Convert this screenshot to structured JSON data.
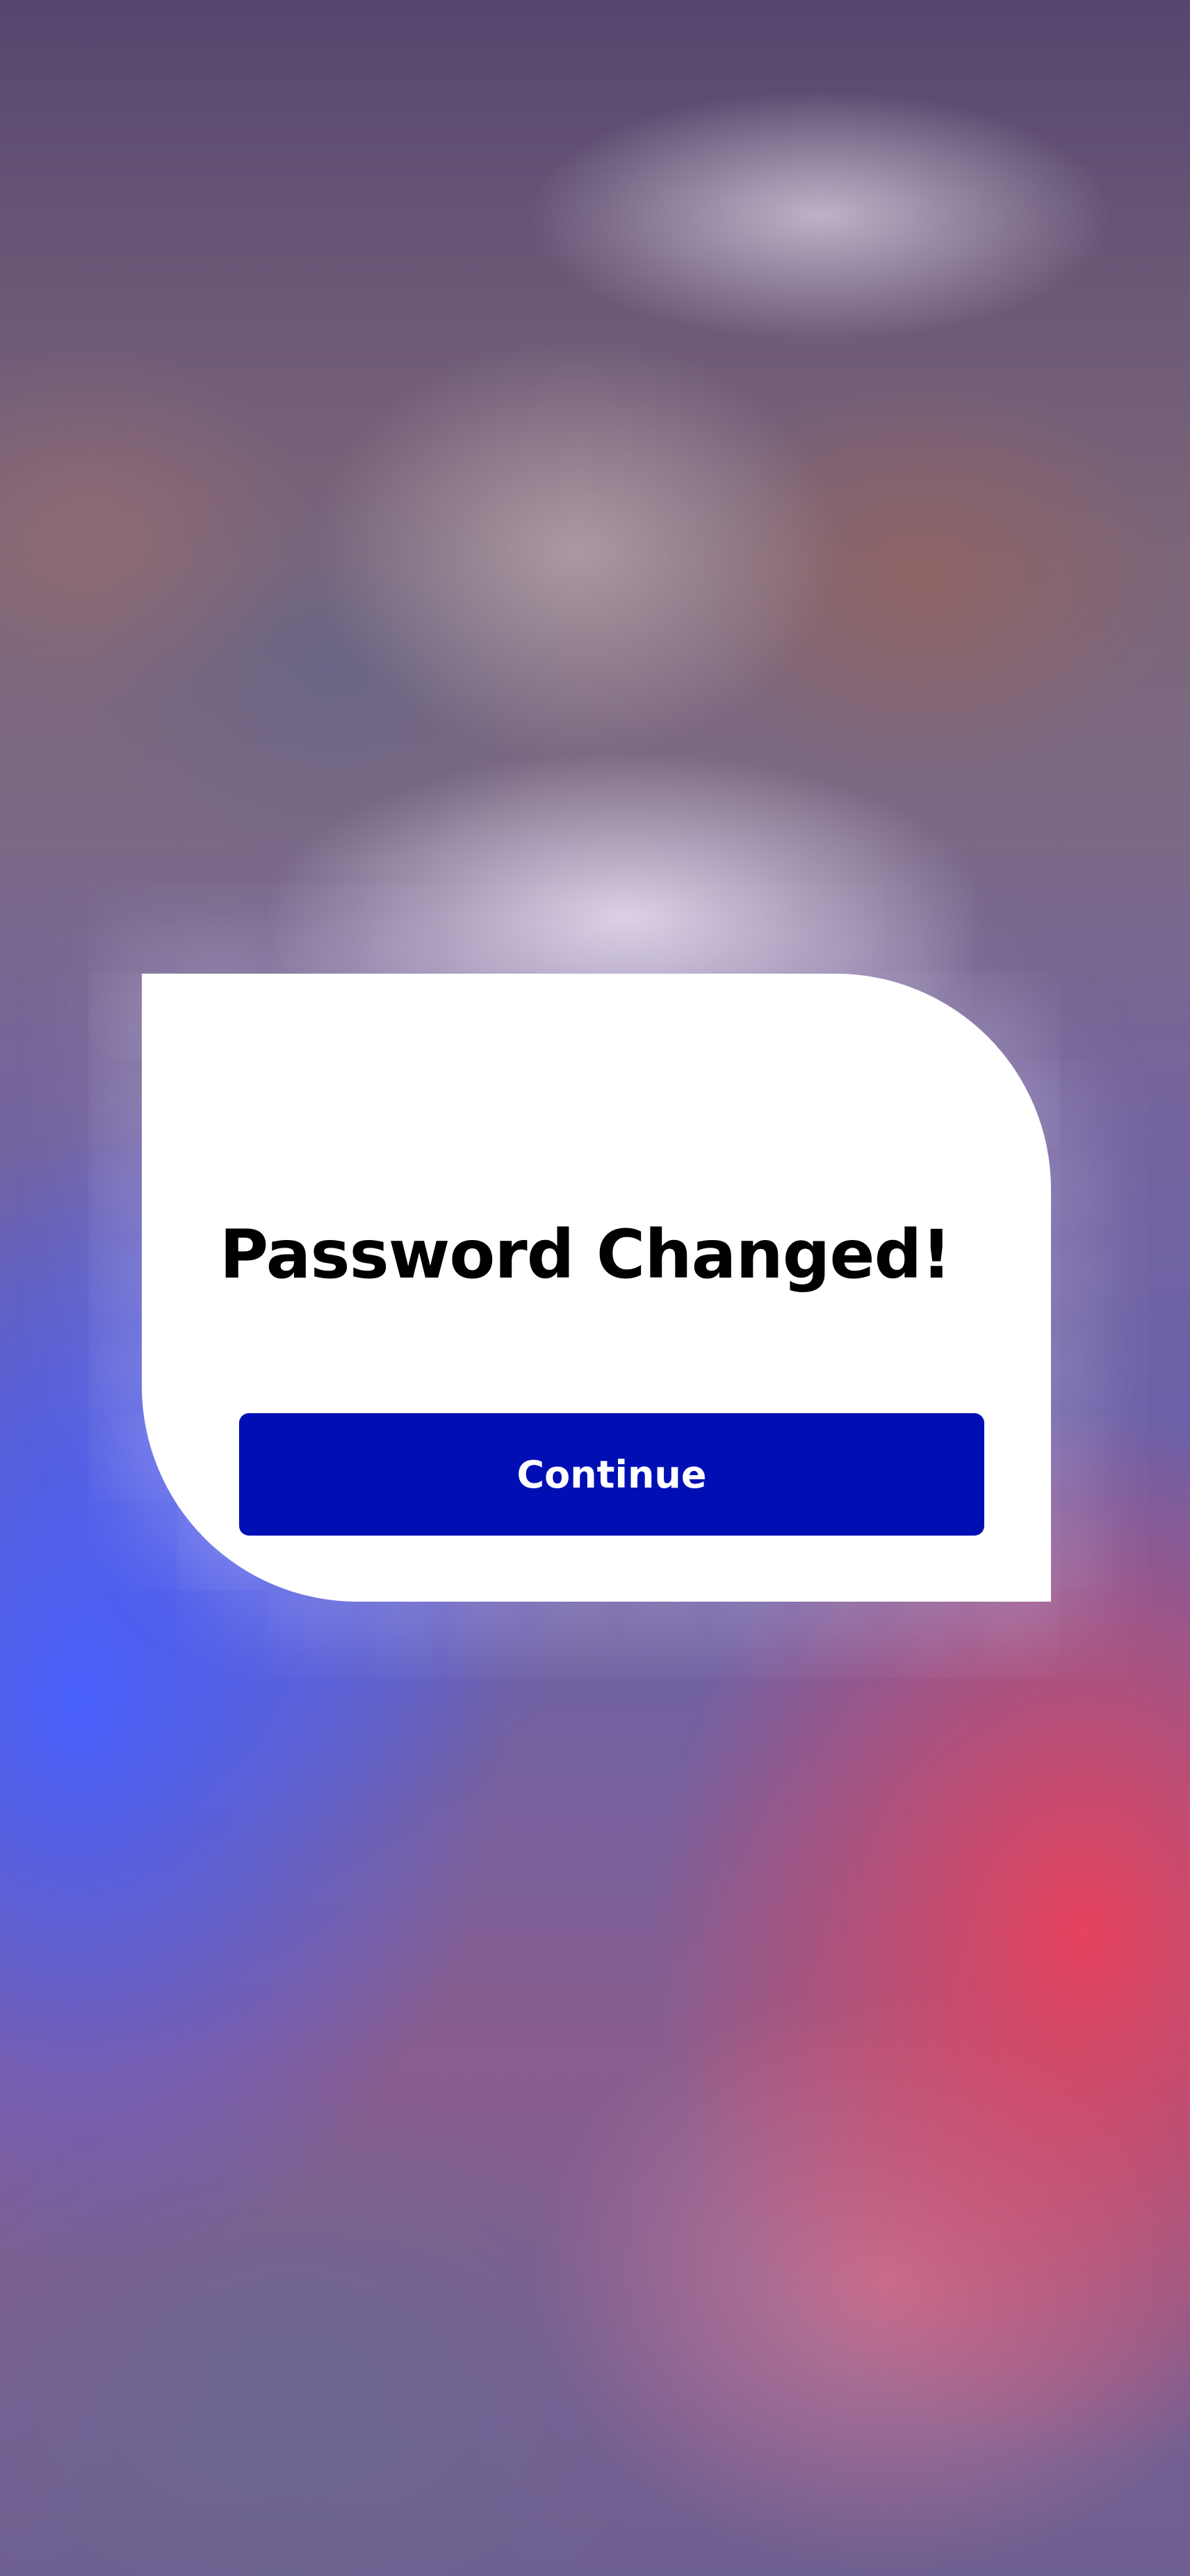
{
  "dialog": {
    "title": "Password Changed!",
    "continue_label": "Continue"
  },
  "colors": {
    "dialog_background": "#ffffff",
    "button_background": "#000fb4",
    "button_text": "#ffffff",
    "title_text": "#000000"
  }
}
